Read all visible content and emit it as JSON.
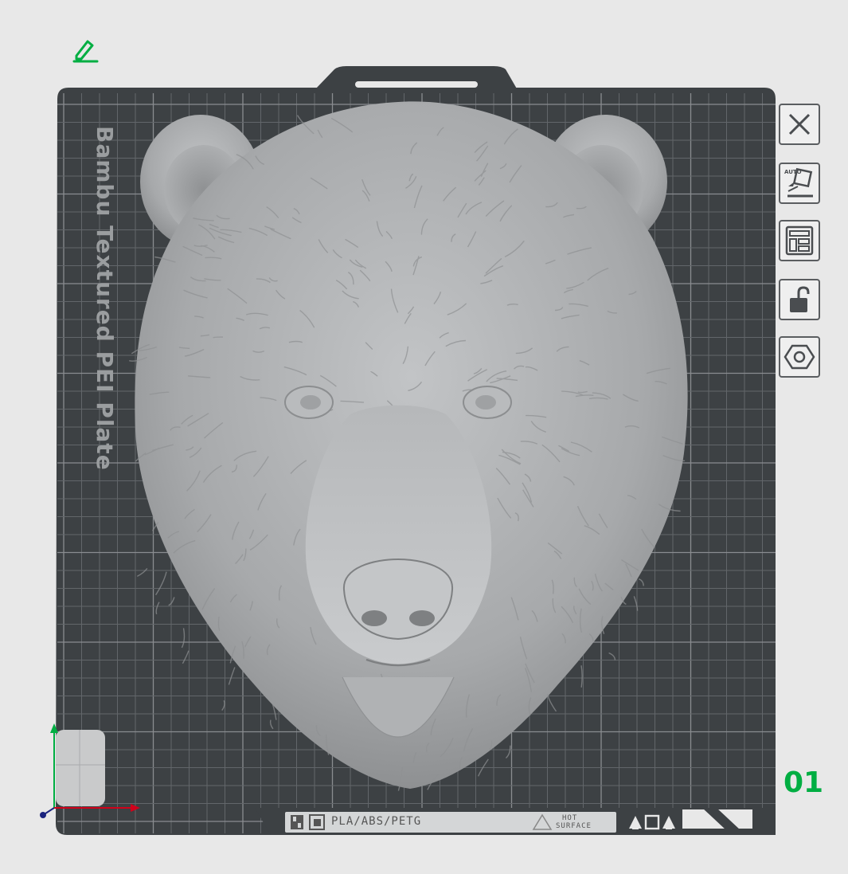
{
  "plate": {
    "name": "Bambu Textured PEI Plate",
    "number": "01",
    "materials": "PLA/ABS/PETG",
    "warning_line1": "HOT",
    "warning_line2": "SURFACE"
  },
  "toolbar": [
    {
      "name": "close-plate-button",
      "icon": "close-icon"
    },
    {
      "name": "auto-orient-button",
      "icon": "auto-orient-icon",
      "badge": "AUTO"
    },
    {
      "name": "arrange-button",
      "icon": "layout-icon"
    },
    {
      "name": "lock-plate-button",
      "icon": "unlock-icon"
    },
    {
      "name": "plate-settings-button",
      "icon": "hexagon-settings-icon"
    }
  ],
  "colors": {
    "accent": "#00ae42",
    "plate": "#3d4144",
    "grid": "#6a6e70",
    "model": "#a9abad",
    "background": "#e8e8e8",
    "x_axis": "#d0021b",
    "y_axis": "#00ae42",
    "origin": "#1a237e"
  },
  "model": {
    "description_icon": "bear-head-model"
  }
}
